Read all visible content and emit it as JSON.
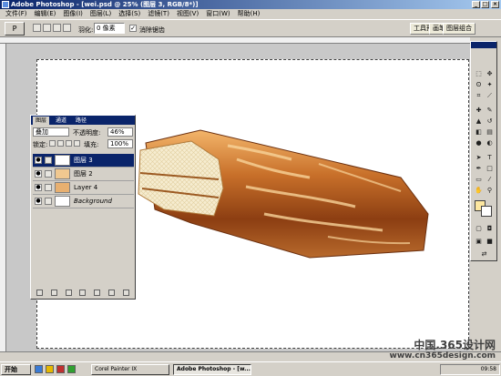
{
  "window": {
    "title": "Adobe Photoshop - [wei.psd @ 25% (图层 3, RGB/8*)]",
    "min": "_",
    "max": "□",
    "close": "×"
  },
  "menu": [
    "文件(F)",
    "编辑(E)",
    "图像(I)",
    "图层(L)",
    "选择(S)",
    "滤镜(T)",
    "视图(V)",
    "窗口(W)",
    "帮助(H)"
  ],
  "options": {
    "tool_icon": "P",
    "feather_label": "羽化:",
    "feather_value": "0 像素",
    "antialias_check": "✓",
    "antialias_label": "消除锯齿",
    "tab_tool_presets": "工具预设",
    "tab_brushes": "画笔",
    "tab_layer_comps": "图层组合"
  },
  "layers_panel": {
    "tabs": [
      "图层",
      "通道",
      "路径"
    ],
    "blend_mode": "叠加",
    "opacity_label": "不透明度:",
    "opacity_value": "46%",
    "lock_label": "锁定:",
    "fill_label": "填充:",
    "fill_value": "100%",
    "layers": [
      {
        "name": "图层 3",
        "visible": "●",
        "active": true
      },
      {
        "name": "图层 2",
        "visible": "●",
        "active": false
      },
      {
        "name": "Layer 4",
        "visible": "●",
        "active": false
      },
      {
        "name": "Background",
        "visible": "●",
        "active": false
      }
    ],
    "bottom_icons": [
      "link",
      "fx",
      "mask",
      "adjust",
      "folder",
      "new",
      "trash"
    ]
  },
  "toolbox": {
    "tools": [
      "marquee",
      "move",
      "lasso",
      "magic-wand",
      "crop",
      "slice",
      "heal",
      "brush",
      "stamp",
      "history-brush",
      "eraser",
      "gradient",
      "blur",
      "dodge",
      "path-select",
      "type",
      "pen",
      "shape",
      "notes",
      "eyedropper",
      "hand",
      "zoom"
    ],
    "fg_color": "#fde7a0",
    "bg_color": "#ffffff"
  },
  "taskbar": {
    "start": "开始",
    "tasks": [
      {
        "label": "Corel Painter IX",
        "active": false
      },
      {
        "label": "Adobe Photoshop - [w...",
        "active": true
      }
    ],
    "time": "09:58"
  },
  "watermark": {
    "line1": "中国.365设计网",
    "line2": "www.cn365design.com"
  }
}
